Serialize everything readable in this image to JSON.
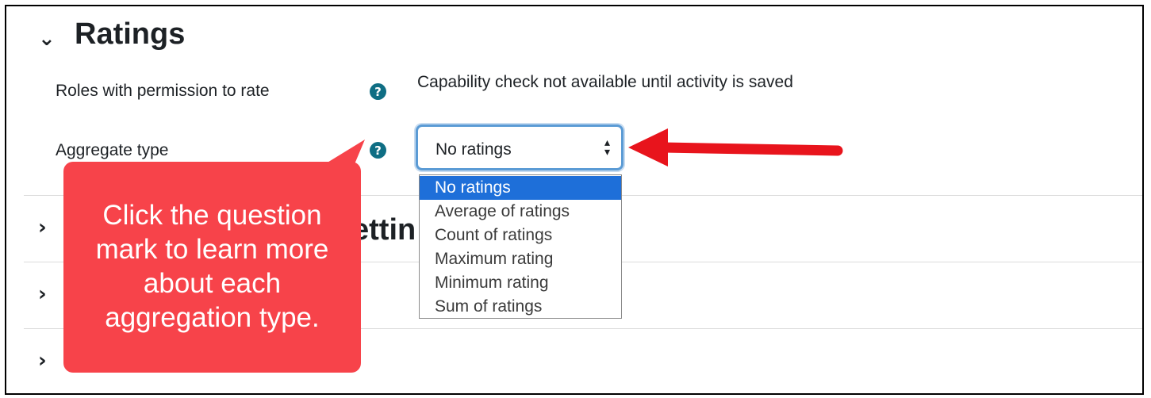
{
  "ratings_section": {
    "title": "Ratings",
    "roles_label": "Roles with permission to rate",
    "roles_value": "Capability check not available until activity is saved",
    "aggregate_label": "Aggregate type",
    "aggregate_select": {
      "selected": "No ratings",
      "options": [
        "No ratings",
        "Average of ratings",
        "Count of ratings",
        "Maximum rating",
        "Minimum rating",
        "Sum of ratings"
      ]
    }
  },
  "collapsed_sections": {
    "partial_heading_visible": "ettin"
  },
  "callout": {
    "text": "Click the question mark to learn more about each aggregation type."
  },
  "colors": {
    "callout": "#f7434a",
    "arrow": "#e8141c",
    "help_icon": "#0f6e84",
    "selected_option": "#1e6fd9",
    "select_focus": "#5b9bd5"
  },
  "icons": {
    "expand": "chevron-down-icon",
    "collapsed": "chevron-right-icon",
    "help": "question-circle-icon",
    "select_caret": "up-down-caret-icon"
  }
}
